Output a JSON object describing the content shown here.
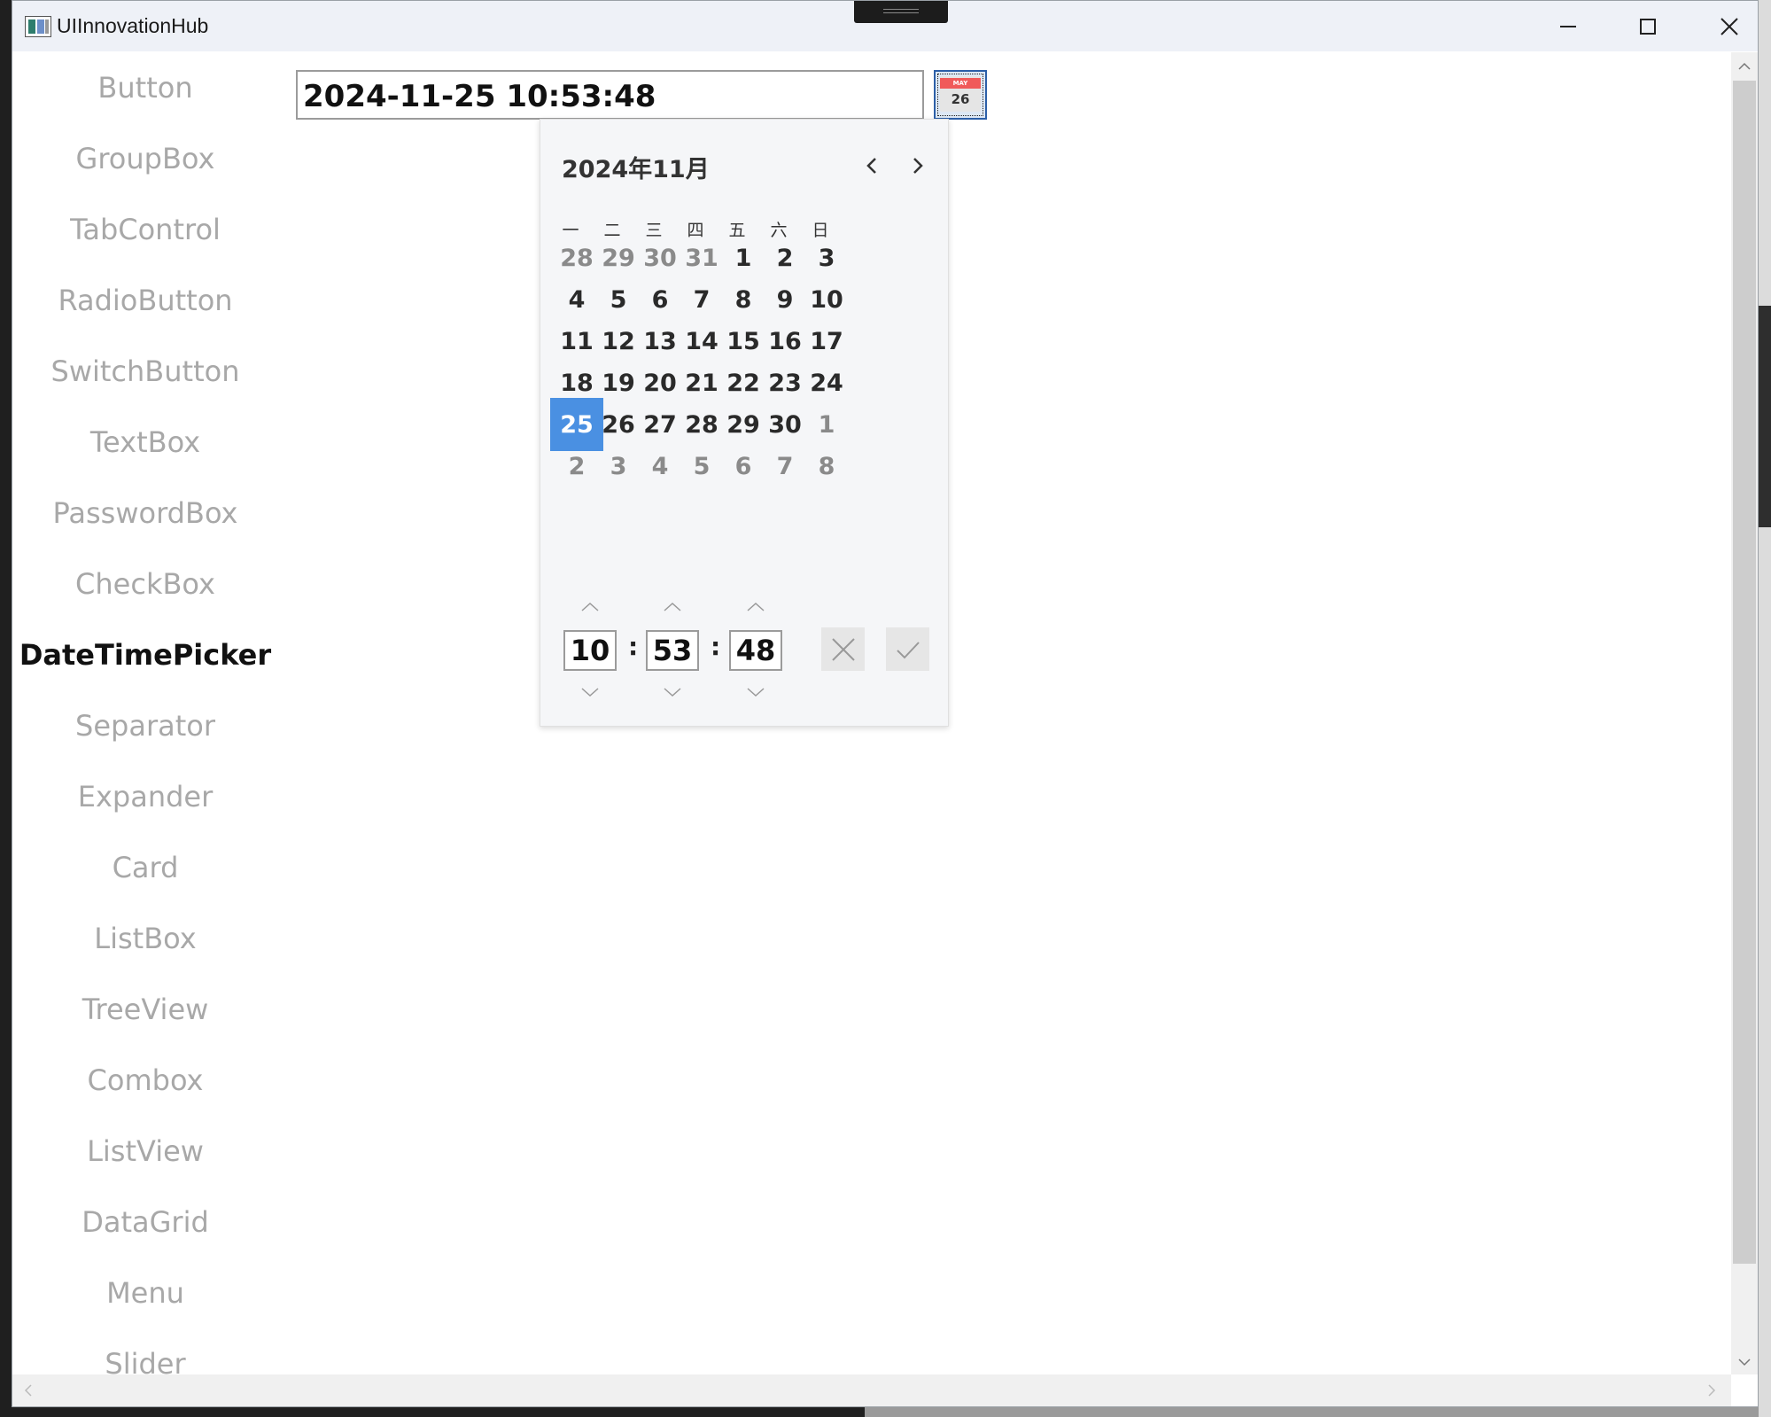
{
  "window": {
    "title": "UIInnovationHub"
  },
  "sidebar": {
    "items": [
      {
        "label": "Button"
      },
      {
        "label": "GroupBox"
      },
      {
        "label": "TabControl"
      },
      {
        "label": "RadioButton"
      },
      {
        "label": "SwitchButton"
      },
      {
        "label": "TextBox"
      },
      {
        "label": "PasswordBox"
      },
      {
        "label": "CheckBox"
      },
      {
        "label": "DateTimePicker"
      },
      {
        "label": "Separator"
      },
      {
        "label": "Expander"
      },
      {
        "label": "Card"
      },
      {
        "label": "ListBox"
      },
      {
        "label": "TreeView"
      },
      {
        "label": "Combox"
      },
      {
        "label": "ListView"
      },
      {
        "label": "DataGrid"
      },
      {
        "label": "Menu"
      },
      {
        "label": "Slider"
      }
    ],
    "active": "DateTimePicker"
  },
  "datetime_picker": {
    "value": "2024-11-25 10:53:48",
    "calendar_icon": {
      "month_label": "MAY",
      "day_label": "26"
    },
    "popup": {
      "month_title": "2024年11月",
      "weekdays": [
        "一",
        "二",
        "三",
        "四",
        "五",
        "六",
        "日"
      ],
      "weeks": [
        [
          "28",
          "29",
          "30",
          "31",
          "1",
          "2",
          "3"
        ],
        [
          "4",
          "5",
          "6",
          "7",
          "8",
          "9",
          "10"
        ],
        [
          "11",
          "12",
          "13",
          "14",
          "15",
          "16",
          "17"
        ],
        [
          "18",
          "19",
          "20",
          "21",
          "22",
          "23",
          "24"
        ],
        [
          "25",
          "26",
          "27",
          "28",
          "29",
          "30",
          "1"
        ],
        [
          "2",
          "3",
          "4",
          "5",
          "6",
          "7",
          "8"
        ]
      ],
      "selected_day": "25",
      "time": {
        "hour": "10",
        "minute": "53",
        "second": "48",
        "separator": ":"
      }
    }
  },
  "colors": {
    "accent": "#4a90e2",
    "inactive_text": "#a8a8a8",
    "active_text": "#111111"
  },
  "icons": [
    "app-icon",
    "minimize-icon",
    "maximize-icon",
    "close-icon",
    "calendar-icon",
    "chevron-left-icon",
    "chevron-right-icon",
    "chevron-up-icon",
    "chevron-down-icon",
    "cancel-icon",
    "confirm-icon"
  ]
}
